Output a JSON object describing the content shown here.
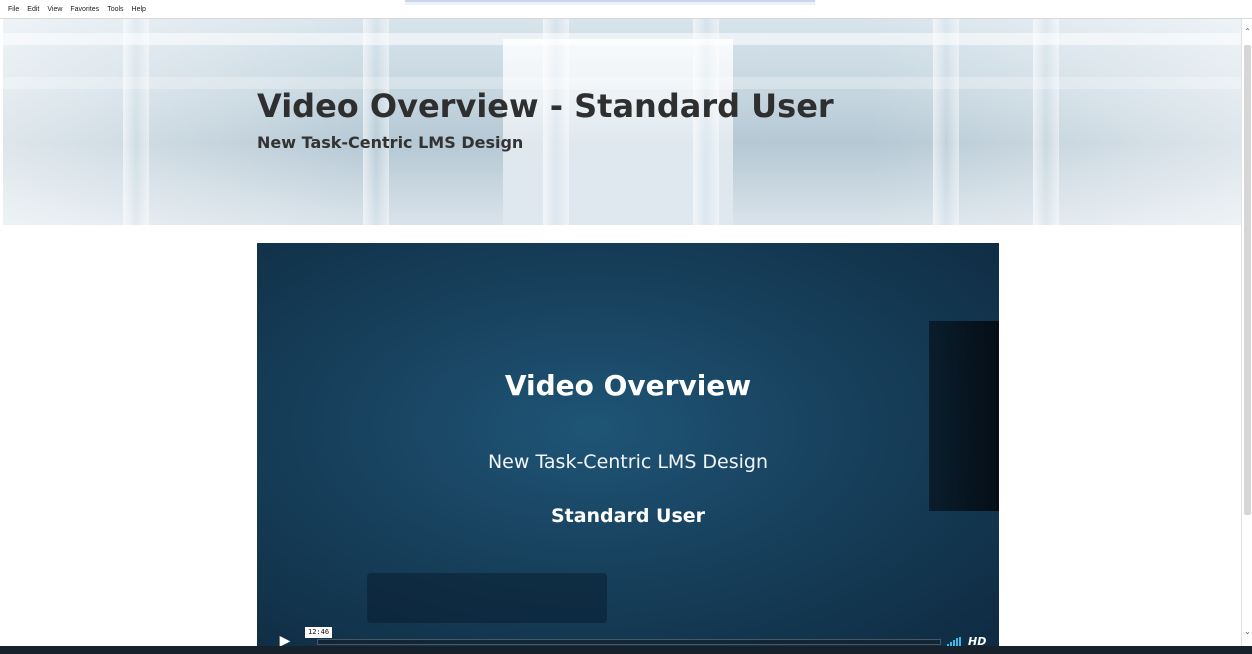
{
  "menubar": {
    "items": [
      "File",
      "Edit",
      "View",
      "Favorites",
      "Tools",
      "Help"
    ]
  },
  "hero": {
    "title": "Video Overview - Standard User",
    "subtitle": "New Task-Centric LMS Design"
  },
  "video": {
    "title": "Video Overview",
    "subtitle": "New Task-Centric LMS Design",
    "role": "Standard User",
    "timecode": "12:46",
    "hd_label": "HD",
    "progress": 0,
    "play_icon": "play-icon",
    "volume_icon": "volume-icon"
  },
  "scrollbar": {
    "up_icon": "chevron-up-icon",
    "down_icon": "chevron-down-icon"
  },
  "colors": {
    "video_background": "#17405c",
    "title_text": "#2f2f2f",
    "volume_accent": "#3db7e4"
  }
}
